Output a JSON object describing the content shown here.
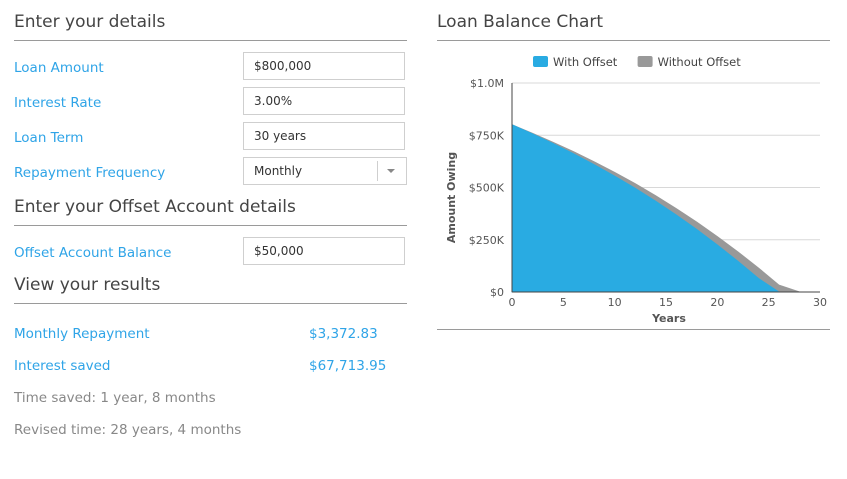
{
  "details": {
    "title": "Enter your details",
    "fields": [
      {
        "label": "Loan Amount",
        "value": "$800,000"
      },
      {
        "label": "Interest Rate",
        "value": "3.00%"
      },
      {
        "label": "Loan Term",
        "value": "30 years"
      }
    ],
    "frequency": {
      "label": "Repayment Frequency",
      "value": "Monthly"
    }
  },
  "offset": {
    "title": "Enter your Offset Account details",
    "label": "Offset Account Balance",
    "value": "$50,000"
  },
  "results": {
    "title": "View your results",
    "monthly_label": "Monthly Repayment",
    "monthly_value": "$3,372.83",
    "saved_label": "Interest saved",
    "saved_value": "$67,713.95",
    "time_saved": "Time saved: 1 year, 8 months",
    "revised_time": "Revised time: 28 years, 4 months"
  },
  "chart": {
    "title": "Loan Balance Chart"
  },
  "chart_data": {
    "type": "area",
    "xlabel": "Years",
    "ylabel": "Amount Owing",
    "xlim": [
      0,
      30
    ],
    "ylim": [
      0,
      1000000
    ],
    "x_ticks": [
      "0",
      "5",
      "10",
      "15",
      "20",
      "25",
      "30"
    ],
    "y_ticks": [
      "$0",
      "$250K",
      "$500K",
      "$750K",
      "$1.0M"
    ],
    "legend_position": "top",
    "series": [
      {
        "name": "Without Offset",
        "color": "#999999",
        "x": [
          0,
          2,
          4,
          6,
          8,
          10,
          12,
          14,
          16,
          18,
          20,
          22,
          24,
          26,
          28,
          30
        ],
        "y": [
          800000,
          759000,
          716000,
          671000,
          623000,
          572000,
          518000,
          460000,
          399000,
          334000,
          265000,
          192000,
          115000,
          33000,
          0,
          0
        ]
      },
      {
        "name": "With Offset",
        "color": "#29abe2",
        "x": [
          0,
          2,
          4,
          6,
          8,
          10,
          12,
          14,
          16,
          18,
          20,
          22,
          24,
          26,
          28,
          28.33
        ],
        "y": [
          800000,
          756000,
          710000,
          661000,
          609000,
          554000,
          496000,
          434000,
          368000,
          299000,
          225000,
          147000,
          65000,
          0,
          0,
          0
        ]
      }
    ]
  }
}
